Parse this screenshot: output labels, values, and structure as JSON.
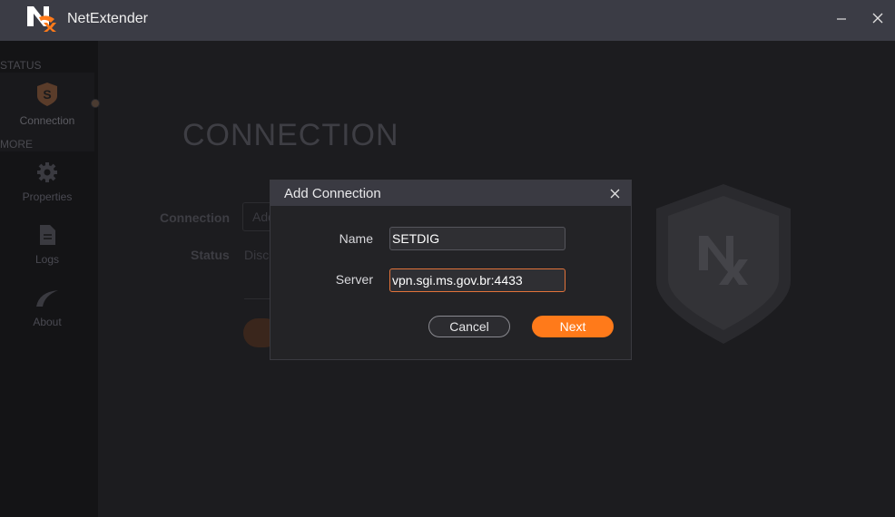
{
  "window": {
    "title": "NetExtender"
  },
  "sidebar": {
    "status_label": "STATUS",
    "more_label": "MORE",
    "items": [
      {
        "label": "Connection",
        "icon": "shield-s-icon"
      },
      {
        "label": "Properties",
        "icon": "gear-icon"
      },
      {
        "label": "Logs",
        "icon": "document-icon"
      },
      {
        "label": "About",
        "icon": "swoosh-icon"
      }
    ]
  },
  "main": {
    "heading": "CONNECTION",
    "connection_label": "Connection",
    "connection_value": "Add",
    "status_label": "Status",
    "status_value": "Disc"
  },
  "dialog": {
    "title": "Add Connection",
    "name_label": "Name",
    "name_value": "SETDIG",
    "server_label": "Server",
    "server_value": "vpn.sgi.ms.gov.br:4433",
    "cancel_label": "Cancel",
    "next_label": "Next"
  },
  "colors": {
    "accent": "#ff7a1a",
    "titlebar": "#3b3c45",
    "background": "#1c1c1f"
  }
}
